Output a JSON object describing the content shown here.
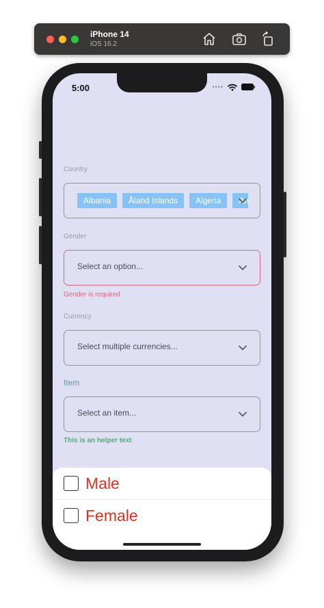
{
  "simulator": {
    "device_name": "iPhone 14",
    "os_version": "iOS 16.2",
    "icons": [
      "home-icon",
      "screenshot-icon",
      "rotate-icon"
    ]
  },
  "status_bar": {
    "time": "5:00",
    "icons": [
      "signal-dots-icon",
      "wifi-icon",
      "battery-icon"
    ]
  },
  "form": {
    "country": {
      "label": "Country",
      "selected_chips": [
        "Albania",
        "Åland Islands",
        "Algeria",
        "Am"
      ]
    },
    "gender": {
      "label": "Gender",
      "placeholder": "Select an option...",
      "error": "Gender is required"
    },
    "currency": {
      "label": "Currency",
      "placeholder": "Select multiple currencies..."
    },
    "item": {
      "label": "Item",
      "placeholder": "Select an item...",
      "helper": "This is an helper text"
    }
  },
  "gender_sheet": {
    "options": [
      {
        "label": "Male",
        "checked": false
      },
      {
        "label": "Female",
        "checked": false
      }
    ]
  },
  "colors": {
    "screen_bg": "#e0e0f4",
    "chip_bg": "#86c3f4",
    "error": "#d6677a",
    "helper": "#4caf72",
    "option_text": "#e0301e",
    "item_label": "#5b9ab0"
  }
}
